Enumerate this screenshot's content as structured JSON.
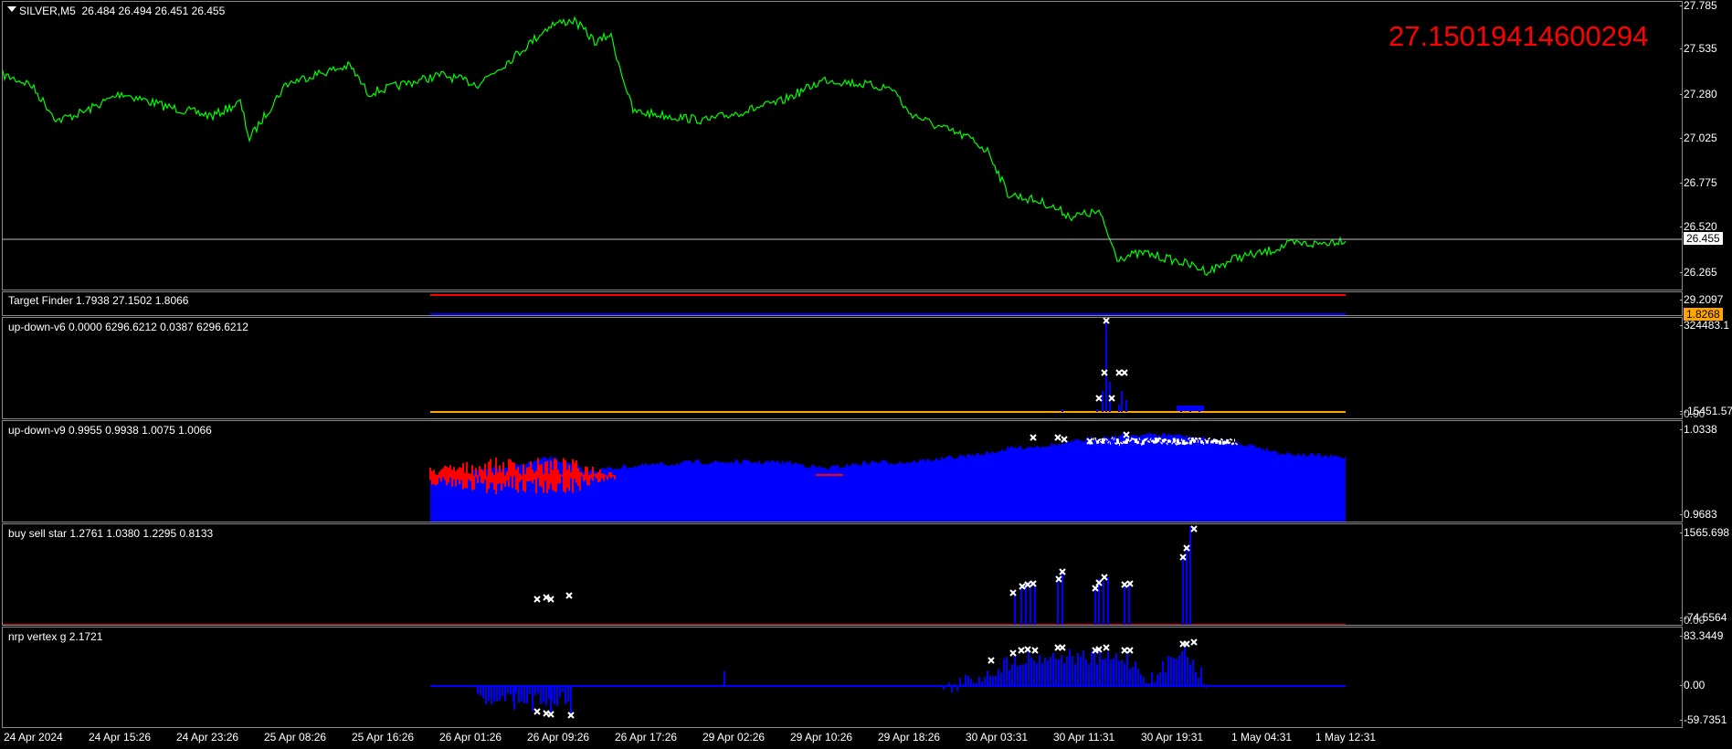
{
  "colors": {
    "background": "#000000",
    "price_line": "#00ff00",
    "bid_line": "#c0c0c0",
    "red": "#ff0000",
    "blue": "#0000ff",
    "orange": "#ffa500",
    "white": "#ffffff",
    "highlight": "#ff0000"
  },
  "main": {
    "symbol_info": "SILVER,M5  26.484 26.494 26.451 26.455",
    "highlight_value": "27.15019414600294",
    "axis_ticks": [
      "27.785",
      "27.535",
      "27.280",
      "27.025",
      "26.775",
      "26.520",
      "26.265"
    ],
    "current_price": "26.455"
  },
  "panes": {
    "target_finder": {
      "title": "Target Finder 1.7938 27.1502 1.8066",
      "axis_top": "29.2097",
      "axis_badge": "1.8268"
    },
    "up_down_v6": {
      "title": "up-down-v6 0.0000 6296.6212 0.0387 6296.6212",
      "axis_top": "324483.1",
      "axis_bottom": "-15451.57",
      "axis_bottom2": "0.00"
    },
    "up_down_v9": {
      "title": "up-down-v9 0.9955 0.9938 1.0075 1.0066",
      "axis_top": "1.0338",
      "axis_bottom": "0.9683"
    },
    "buy_sell_star": {
      "title": "buy sell star 1.2761 1.0380 1.2295 0.8133",
      "axis_top": "1565.698",
      "axis_bottom": "-74.5564",
      "axis_bottom2": "0.00"
    },
    "nrp_vertex": {
      "title": "nrp vertex g 2.1721",
      "axis_top": "83.3449",
      "axis_mid": "0.00",
      "axis_bottom": "-59.7351"
    }
  },
  "x_axis": {
    "labels": [
      "24 Apr 2024",
      "24 Apr 15:26",
      "24 Apr 23:26",
      "25 Apr 08:26",
      "25 Apr 16:26",
      "26 Apr 01:26",
      "26 Apr 09:26",
      "26 Apr 17:26",
      "29 Apr 02:26",
      "29 Apr 10:26",
      "29 Apr 18:26",
      "30 Apr 03:31",
      "30 Apr 11:31",
      "30 Apr 19:31",
      "1 May 04:31",
      "1 May 12:31"
    ]
  }
}
